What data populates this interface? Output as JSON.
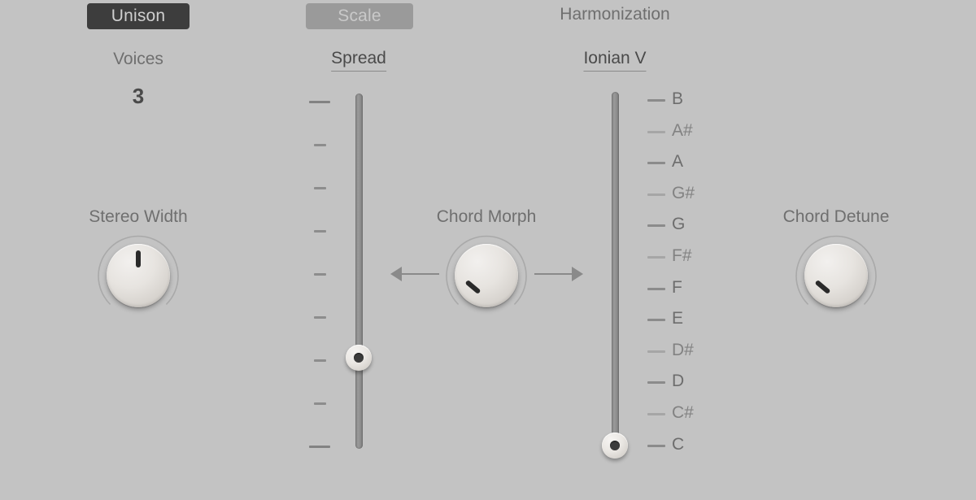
{
  "panel": {
    "background_color": "#c3c3c3",
    "accent_dark": "#3d3d3d",
    "text_color": "#6f6f6f"
  },
  "unison_section": {
    "tab_label": "Unison",
    "tab_active": true,
    "voices_label": "Voices",
    "voices_value": "3",
    "stereo_width_label": "Stereo Width",
    "stereo_width_position": "center"
  },
  "scale_section": {
    "tab_label": "Scale",
    "tab_active": false,
    "spread_label": "Spread",
    "spread_ticks": 9
  },
  "harmonization_section": {
    "title": "Harmonization",
    "mode_label": "Ionian V",
    "chord_morph_label": "Chord Morph",
    "chord_detune_label": "Chord Detune",
    "selected_note": "C",
    "notes": [
      {
        "name": "B",
        "kind": "natural"
      },
      {
        "name": "A#",
        "kind": "sharp"
      },
      {
        "name": "A",
        "kind": "natural"
      },
      {
        "name": "G#",
        "kind": "sharp"
      },
      {
        "name": "G",
        "kind": "natural"
      },
      {
        "name": "F#",
        "kind": "sharp"
      },
      {
        "name": "F",
        "kind": "natural"
      },
      {
        "name": "E",
        "kind": "natural"
      },
      {
        "name": "D#",
        "kind": "sharp"
      },
      {
        "name": "D",
        "kind": "natural"
      },
      {
        "name": "C#",
        "kind": "sharp"
      },
      {
        "name": "C",
        "kind": "natural"
      }
    ]
  }
}
